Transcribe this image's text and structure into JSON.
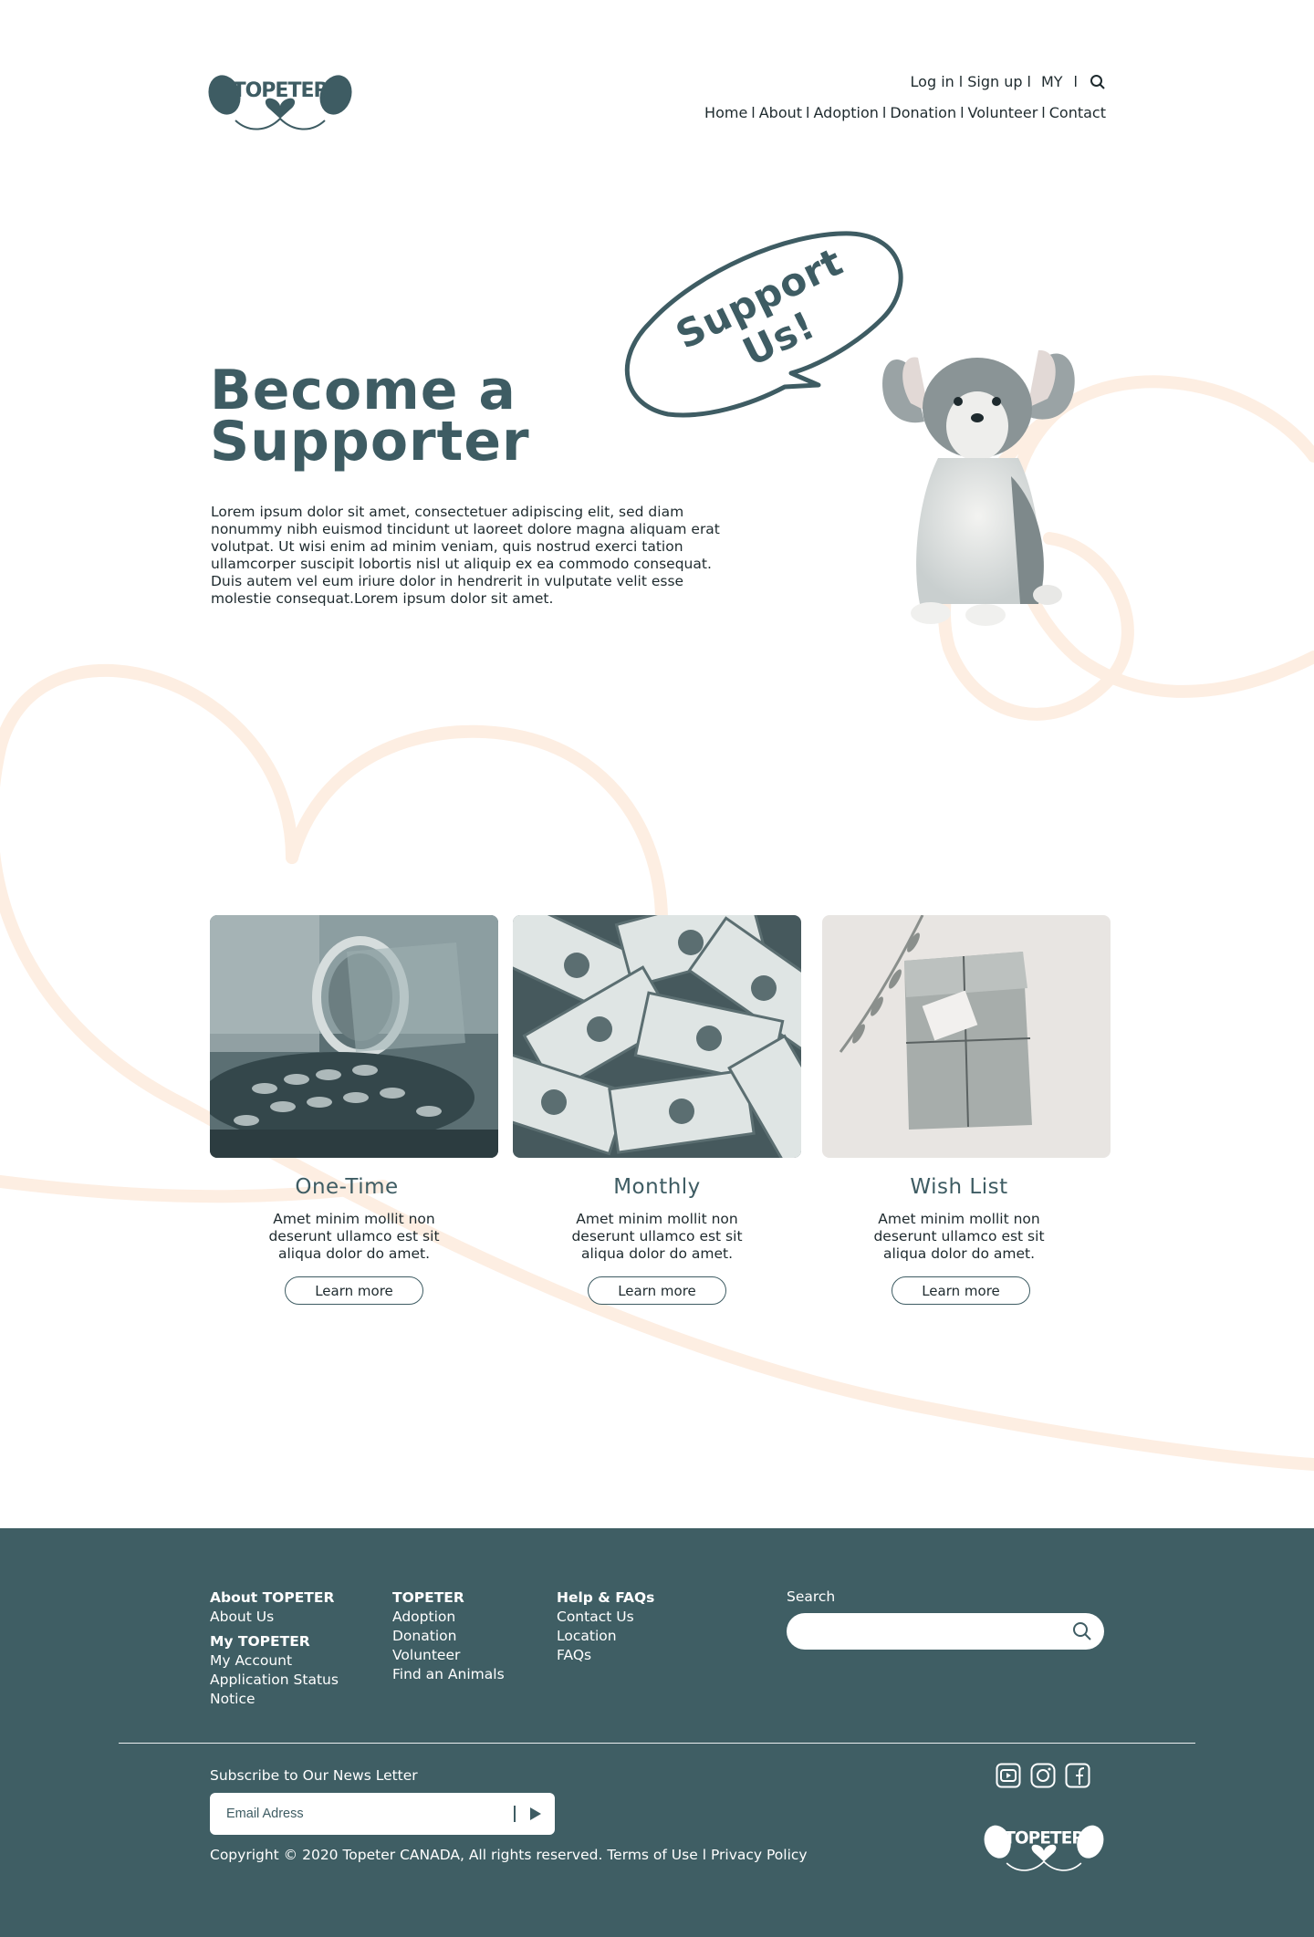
{
  "brand": {
    "name": "TOPETER",
    "primary_color": "#3f5e64",
    "accent_color": "#fdeee2"
  },
  "topnav": {
    "login": "Log in",
    "signup": "Sign up",
    "my": "MY",
    "sep": "l"
  },
  "mainnav": {
    "items": [
      "Home",
      "About",
      "Adoption",
      "Donation",
      "Volunteer",
      "Contact"
    ],
    "sep": "l"
  },
  "hero": {
    "title_line1": "Become a",
    "title_line2": "Supporter",
    "body": "Lorem ipsum dolor sit amet, consectetuer adipiscing elit, sed diam nonummy nibh euismod tincidunt ut laoreet dolore magna aliquam erat volutpat. Ut wisi enim ad minim veniam, quis nostrud exerci tation ullamcorper suscipit lobortis nisl ut aliquip ex ea commodo consequat. Duis autem vel eum iriure dolor in hendrerit in vulputate velit esse molestie consequat.Lorem ipsum dolor sit amet.",
    "bubble": "Support Us!"
  },
  "cards": [
    {
      "title": "One-Time",
      "desc": "Amet minim mollit non deserunt ullamco est sit aliqua dolor do amet.",
      "button": "Learn more",
      "image": "coin-jar-photo"
    },
    {
      "title": "Monthly",
      "desc": "Amet minim mollit non deserunt ullamco est sit aliqua dolor do amet.",
      "button": "Learn more",
      "image": "dollar-bills-photo"
    },
    {
      "title": "Wish List",
      "desc": "Amet minim mollit non deserunt ullamco est sit aliqua dolor do amet.",
      "button": "Learn more",
      "image": "gift-package-photo"
    }
  ],
  "footer": {
    "col1": {
      "h1": "About TOPETER",
      "l1": [
        "About Us"
      ],
      "h2": "My TOPETER",
      "l2": [
        "My Account",
        "Application Status",
        "Notice"
      ]
    },
    "col2": {
      "h": "TOPETER",
      "links": [
        "Adoption",
        "Donation",
        "Volunteer",
        "Find an Animals"
      ]
    },
    "col3": {
      "h": "Help & FAQs",
      "links": [
        "Contact Us",
        "Location",
        "FAQs"
      ]
    },
    "search_label": "Search",
    "subscribe_label": "Subscribe to Our News Letter",
    "email_placeholder": "Email Adress",
    "copyright": "Copyright © 2020 Topeter CANADA, All rights reserved.",
    "terms": "Terms of Use",
    "privacy": "Privacy Policy",
    "sep": "l",
    "social": [
      "youtube-icon",
      "instagram-icon",
      "facebook-icon"
    ]
  }
}
